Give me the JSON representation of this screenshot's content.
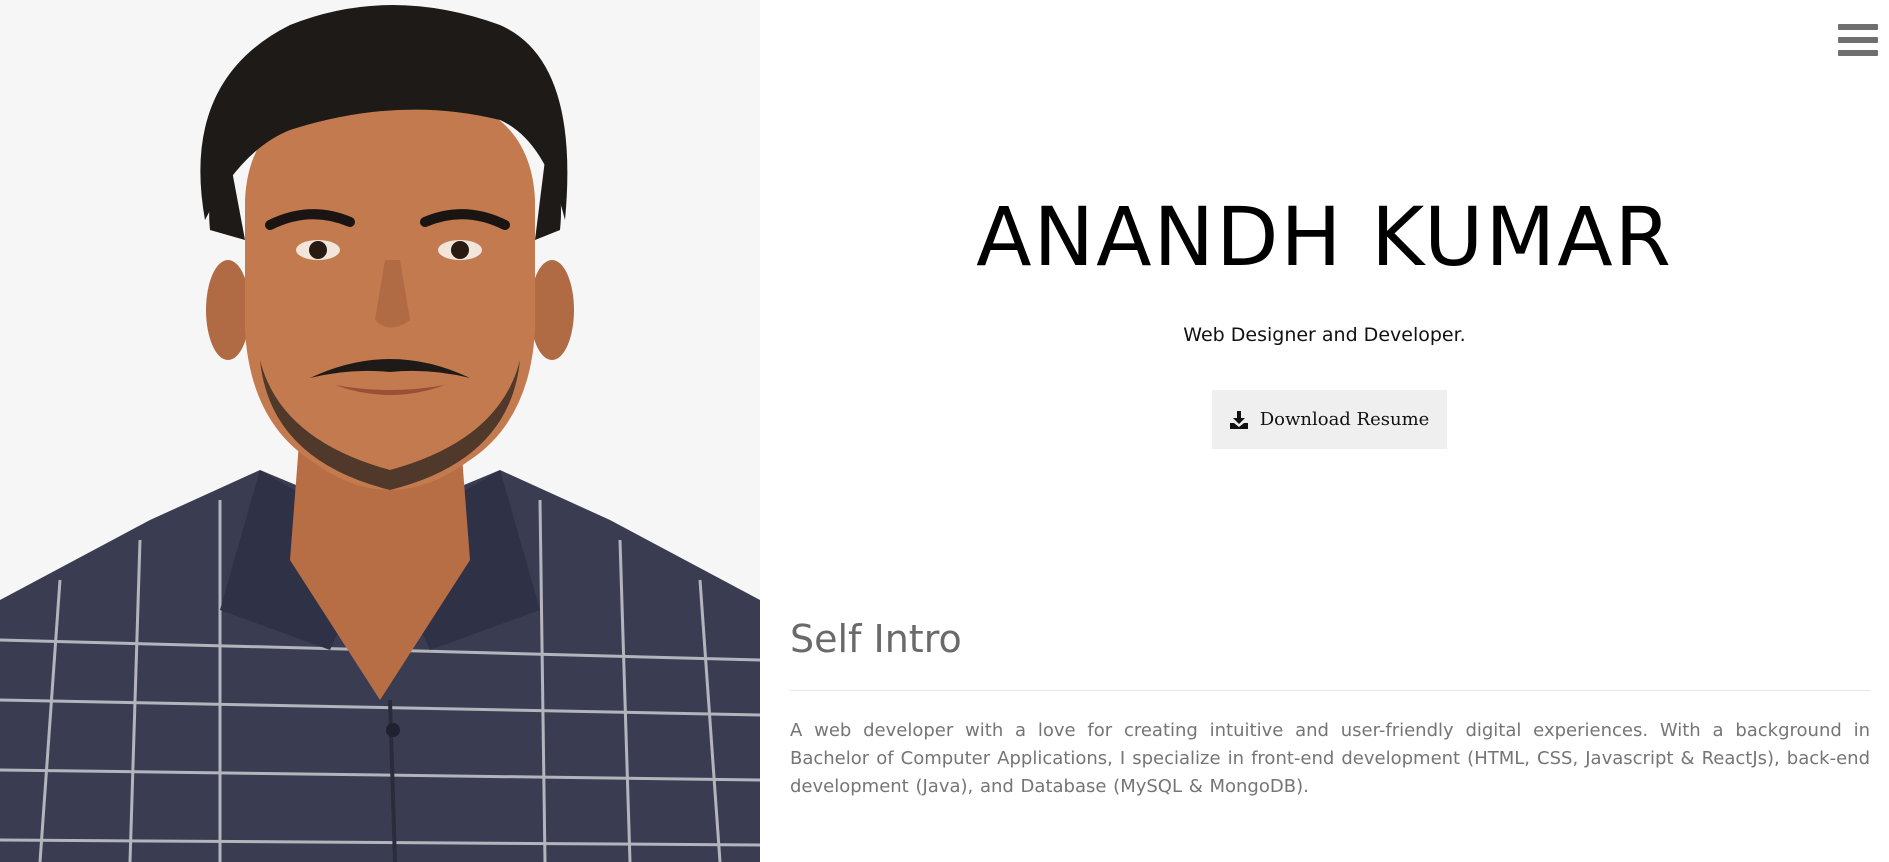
{
  "hero": {
    "name": "ANANDH KUMAR",
    "tagline": "Web Designer and Developer.",
    "resume_button_label": "Download Resume"
  },
  "intro": {
    "title": "Self Intro",
    "text": "A web developer with a love for creating intuitive and user-friendly digital experiences. With a background in Bachelor of Computer Applications, I specialize in front-end development (HTML, CSS, Javascript & ReactJs), back-end development (Java), and Database (MySQL & MongoDB)."
  },
  "icons": {
    "menu": "hamburger-menu-icon",
    "download": "download-icon"
  },
  "colors": {
    "background": "#ffffff",
    "button_bg": "#efefef",
    "menu_icon": "#6f6f6f",
    "intro_text": "#757575"
  }
}
